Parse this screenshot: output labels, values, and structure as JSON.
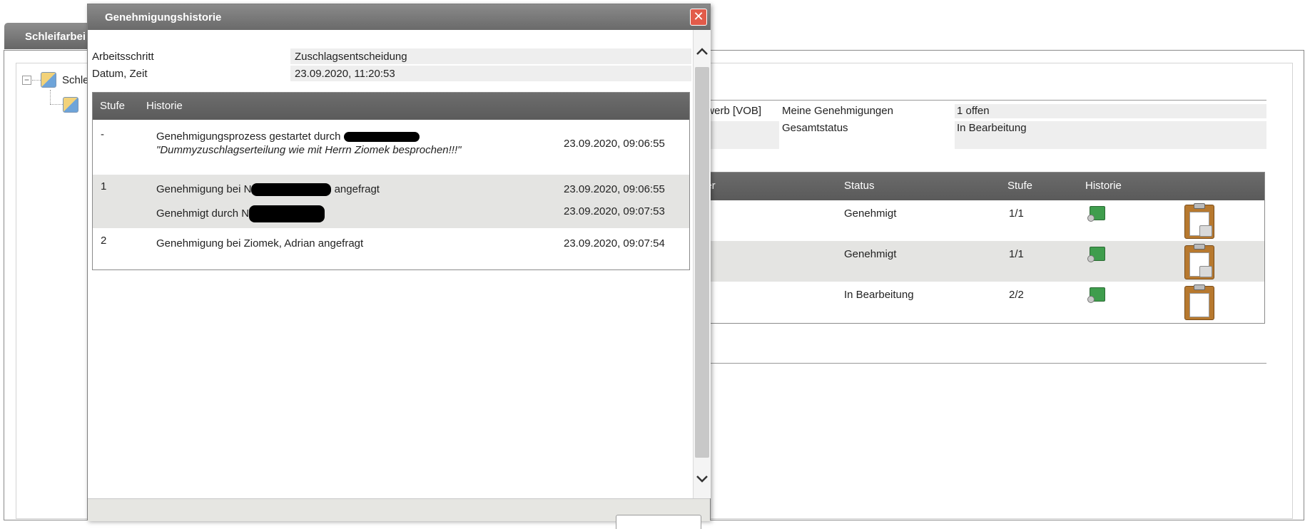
{
  "background": {
    "tab_label": "Schleifarbei",
    "tree_root_label": "Schle",
    "info_rows": [
      {
        "left_value": "ewerb [VOB]",
        "label": "Meine Genehmigungen",
        "value": "1 offen"
      },
      {
        "left_value": "",
        "label": "Gesamtstatus",
        "value": "In Bearbeitung"
      }
    ],
    "table": {
      "headers": [
        "ger",
        "Status",
        "Stufe",
        "Historie"
      ],
      "rows": [
        {
          "status": "Genehmigt",
          "stufe": "1/1",
          "locked": true
        },
        {
          "status": "Genehmigt",
          "stufe": "1/1",
          "locked": true
        },
        {
          "status": "In Bearbeitung",
          "stufe": "2/2",
          "locked": false
        }
      ]
    }
  },
  "dialog": {
    "title": "Genehmigungshistorie",
    "close_icon": "close-icon",
    "fields": [
      {
        "label": "Arbeitsschritt",
        "value": "Zuschlagsentscheidung"
      },
      {
        "label": "Datum, Zeit",
        "value": "23.09.2020, 11:20:53"
      }
    ],
    "history_table": {
      "headers": {
        "stufe": "Stufe",
        "historie": "Historie"
      },
      "rows": [
        {
          "stufe": "-",
          "entries": [
            {
              "text": "Genehmigungsprozess gestartet durch ",
              "time": "23.09.2020, 09:06:55"
            }
          ],
          "comment": "\"Dummyzuschlagserteilung wie mit Herrn Ziomek besprochen!!!\""
        },
        {
          "stufe": "1",
          "entries": [
            {
              "text_before": "Genehmigung bei N",
              "text_after": " angefragt",
              "time": "23.09.2020, 09:06:55"
            },
            {
              "text": "Genehmigt durch N",
              "time": "23.09.2020, 09:07:53"
            }
          ]
        },
        {
          "stufe": "2",
          "entries": [
            {
              "text": "Genehmigung bei Ziomek, Adrian angefragt",
              "time": "23.09.2020, 09:07:54"
            }
          ]
        }
      ]
    },
    "scroll_up_icon": "chevron-up-icon",
    "scroll_down_icon": "chevron-down-icon"
  }
}
